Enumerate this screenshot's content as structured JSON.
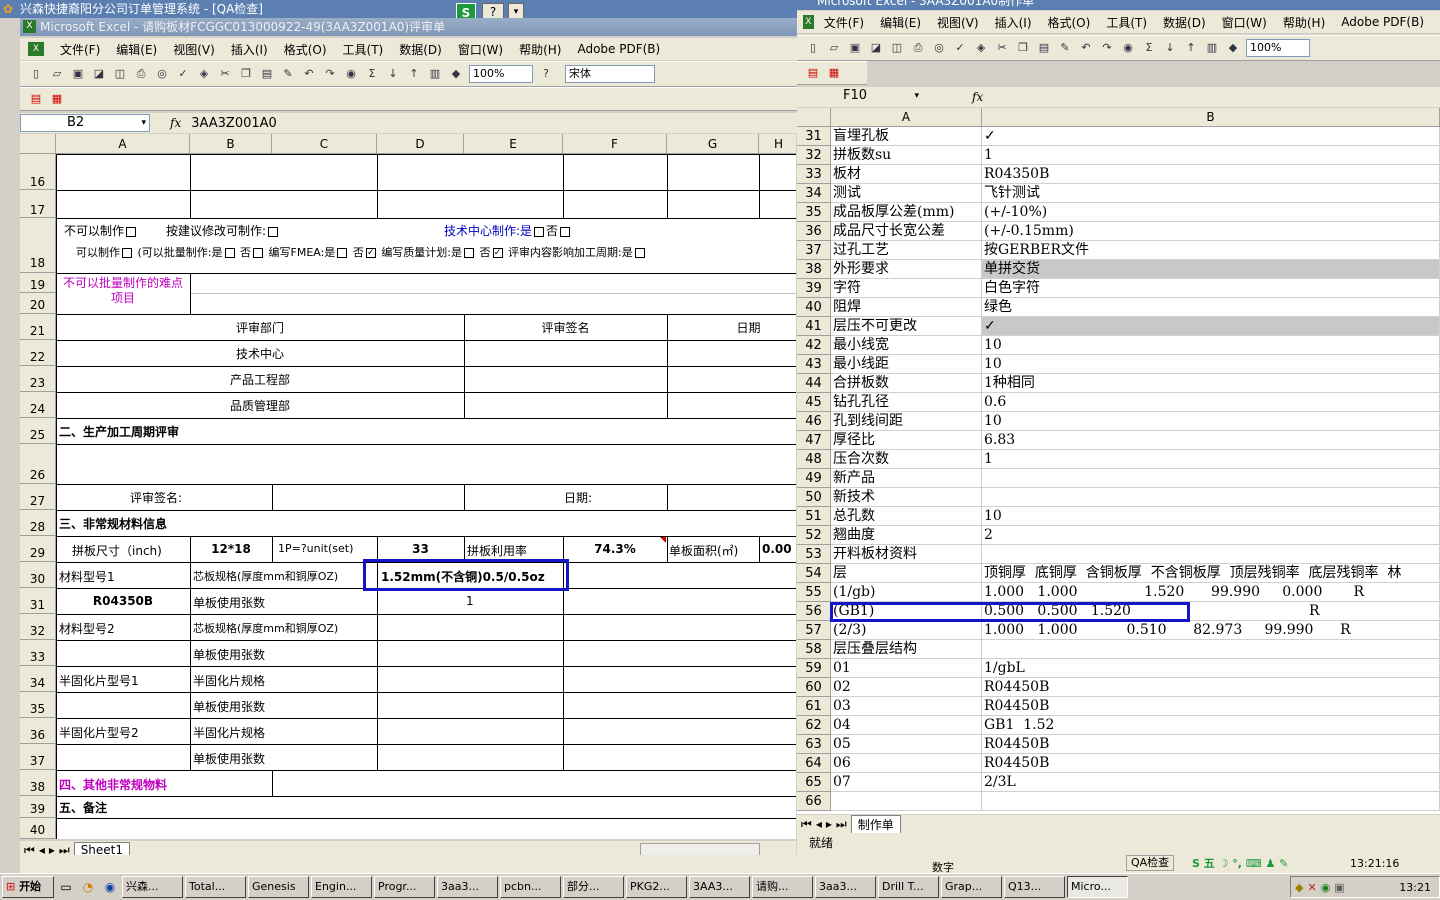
{
  "left_window": {
    "outer_title": "兴森快捷裔阳分公司订单管理系统 - [QA检查]",
    "title": "Microsoft Excel - 请购板材FCGGC013000922-49(3AA3Z001A0)评审单",
    "menu": [
      "文件(F)",
      "编辑(E)",
      "视图(V)",
      "插入(I)",
      "格式(O)",
      "工具(T)",
      "数据(D)",
      "窗口(W)",
      "帮助(H)",
      "Adobe PDF(B)"
    ],
    "zoom": "100%",
    "font": "宋体",
    "name_box": "B2",
    "formula": "3AA3Z001A0",
    "columns": [
      "A",
      "B",
      "C",
      "D",
      "E",
      "F",
      "G",
      "H"
    ],
    "rows": [
      "16",
      "17",
      "18",
      "19",
      "20",
      "21",
      "22",
      "23",
      "24",
      "25",
      "26",
      "27",
      "28",
      "29",
      "30",
      "31",
      "32",
      "33",
      "34",
      "35",
      "36",
      "37",
      "38",
      "39",
      "40"
    ],
    "r18": {
      "cannot_make": "不可以制作",
      "suggest_modify": "按建议修改可制作:",
      "tech_center": "技术中心制作:是",
      "no1": "否",
      "can_make": "可以制作",
      "batch": "(可以批量制作:是",
      "no2": "否",
      "fmea": "编写FMEA:是",
      "no3": "否",
      "quality_plan": "编写质量计划:是",
      "no4": "否",
      "cycle": "评审内容影响加工周期:是"
    },
    "r19_label": "不可以批量制作的难点项目",
    "review_dept": "评审部门",
    "review_sign": "评审签名",
    "date": "日期",
    "depts": [
      "技术中心",
      "产品工程部",
      "品质管理部"
    ],
    "sec2": "二、生产加工周期评审",
    "sign_label": "评审签名:",
    "date_label": "日期:",
    "sec3": "三、非常规材料信息",
    "panel_size_label": "拼板尺寸（inch)",
    "panel_size": "12*18",
    "unit_label": "1P=?unit(set)",
    "unit_val": "33",
    "util_label": "拼板利用率",
    "util_val": "74.3%",
    "area_label": "单板面积(㎡)",
    "area_val": "0.00",
    "mat1": "材料型号1",
    "core_spec": "芯板规格(厚度mm和铜厚OZ)",
    "core_val": "1.52mm(不含铜)0.5/0.5oz",
    "mat1_val": "R04350B",
    "board_count": "单板使用张数",
    "board_count_val": "1",
    "mat2": "材料型号2",
    "core_spec2": "芯板规格(厚度mm和铜厚OZ)",
    "board_count2": "单板使用张数",
    "pp1": "半固化片型号1",
    "pp_spec": "半固化片规格",
    "board_count3": "单板使用张数",
    "pp2": "半固化片型号2",
    "pp_spec2": "半固化片规格",
    "board_count4": "单板使用张数",
    "sec4": "四、其他非常规物料",
    "sec5": "五、备注",
    "sheet_tab": "Sheet1",
    "status": "就绪"
  },
  "right_window": {
    "title": "Microsoft Excel - 3AA3Z001A0制作单",
    "menu": [
      "文件(F)",
      "编辑(E)",
      "视图(V)",
      "插入(I)",
      "格式(O)",
      "工具(T)",
      "数据(D)",
      "窗口(W)",
      "帮助(H)",
      "Adobe PDF(B)"
    ],
    "zoom": "100%",
    "name_box": "F10",
    "columns": [
      "A",
      "B"
    ],
    "rows": [
      {
        "n": "31",
        "a": "盲埋孔板",
        "b": "✓"
      },
      {
        "n": "32",
        "a": "拼板数su",
        "b": "1"
      },
      {
        "n": "33",
        "a": "板材",
        "b": "R04350B"
      },
      {
        "n": "34",
        "a": "测试",
        "b": "飞针测试"
      },
      {
        "n": "35",
        "a": "成品板厚公差(mm)",
        "b": "(+/-10%)"
      },
      {
        "n": "36",
        "a": "成品尺寸长宽公差",
        "b": "(+/-0.15mm)"
      },
      {
        "n": "37",
        "a": "过孔工艺",
        "b": "按GERBER文件"
      },
      {
        "n": "38",
        "a": "外形要求",
        "b": "单拼交货"
      },
      {
        "n": "39",
        "a": "字符",
        "b": "白色字符"
      },
      {
        "n": "40",
        "a": "阻焊",
        "b": "绿色"
      },
      {
        "n": "41",
        "a": "层压不可更改",
        "b": "✓"
      },
      {
        "n": "42",
        "a": "最小线宽",
        "b": "10"
      },
      {
        "n": "43",
        "a": "最小线距",
        "b": "10"
      },
      {
        "n": "44",
        "a": "合拼板数",
        "b": "1种相同"
      },
      {
        "n": "45",
        "a": "钻孔孔径",
        "b": "0.6"
      },
      {
        "n": "46",
        "a": "孔到线间距",
        "b": "10"
      },
      {
        "n": "47",
        "a": "厚径比",
        "b": "6.83"
      },
      {
        "n": "48",
        "a": "压合次数",
        "b": "1"
      },
      {
        "n": "49",
        "a": "新产品",
        "b": ""
      },
      {
        "n": "50",
        "a": "新技术",
        "b": ""
      },
      {
        "n": "51",
        "a": "总孔数",
        "b": "10"
      },
      {
        "n": "52",
        "a": "翘曲度",
        "b": "2"
      },
      {
        "n": "53",
        "a": "开料板材资料",
        "b": ""
      },
      {
        "n": "54",
        "a": "层",
        "b": "顶铜厚  底铜厚  含铜板厚  不含铜板厚  顶层残铜率  底层残铜率  林"
      },
      {
        "n": "55",
        "a": "(1/gb)",
        "b": "1.000   1.000               1.520      99.990     0.000       R"
      },
      {
        "n": "56",
        "a": "(GB1)",
        "b": "0.500   0.500   1.520                                        R"
      },
      {
        "n": "57",
        "a": "(2/3)",
        "b": "1.000   1.000           0.510      82.973     99.990      R"
      },
      {
        "n": "58",
        "a": "层压叠层结构",
        "b": ""
      },
      {
        "n": "59",
        "a": "01",
        "b": "1/gbL"
      },
      {
        "n": "60",
        "a": "02",
        "b": "R04450B"
      },
      {
        "n": "61",
        "a": "03",
        "b": "R04450B"
      },
      {
        "n": "62",
        "a": "04",
        "b": "GB1  1.52"
      },
      {
        "n": "63",
        "a": "05",
        "b": "R04450B"
      },
      {
        "n": "64",
        "a": "06",
        "b": "R04450B"
      },
      {
        "n": "65",
        "a": "07",
        "b": "2/3L"
      },
      {
        "n": "66",
        "a": "",
        "b": ""
      }
    ],
    "sheet_tab": "制作单",
    "status": "就绪"
  },
  "status_extra": {
    "digits": "数字",
    "qa": "QA检查",
    "time": "13:21:16"
  },
  "taskbar": {
    "start": "开始",
    "items": [
      "兴森...",
      "Total...",
      "Genesis",
      "Engin...",
      "Progr...",
      "3aa3...",
      "pcbn...",
      "部分...",
      "PKG2...",
      "3AA3...",
      "请购...",
      "3aa3...",
      "Drill T...",
      "Grap...",
      "Q13...",
      "Micro..."
    ],
    "clock": "13:21"
  }
}
